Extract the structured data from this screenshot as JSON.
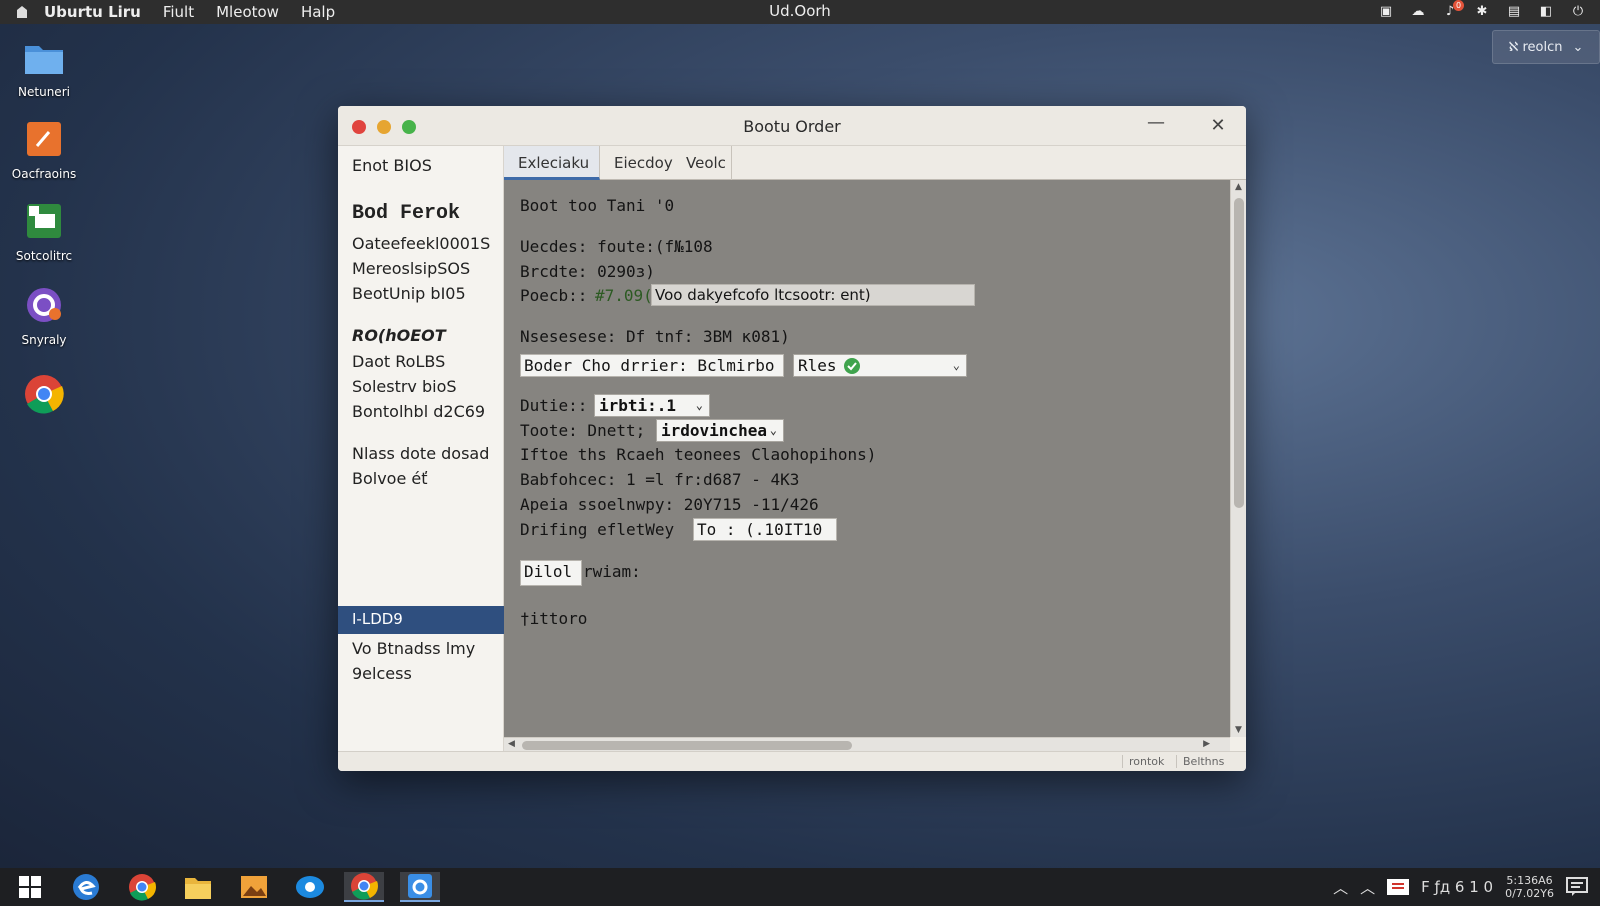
{
  "topbar": {
    "app_name": "Uburtu Liru",
    "menus": [
      "Fiult",
      "Mleotow",
      "Halp"
    ],
    "center_title": "Ud.Oorh",
    "tray_badge": "0"
  },
  "screen_button": {
    "label": "ℵ reolcn"
  },
  "desktop_icons": [
    {
      "label": "Netuneri",
      "icon": "folder-icon"
    },
    {
      "label": "Oacfraoins",
      "icon": "tools-app-icon"
    },
    {
      "label": "Sotcolitrc",
      "icon": "spreadsheet-app-icon"
    },
    {
      "label": "Snyraly",
      "icon": "chat-app-icon"
    },
    {
      "label": "",
      "icon": "chrome-icon"
    }
  ],
  "window": {
    "title": "Bootu Order",
    "minimize_glyph": "—",
    "close_glyph": "✕"
  },
  "sidebar": {
    "top": "Enot BIOS",
    "heading": "Bod Ferok",
    "group1": [
      "Oateefeekl0001S",
      "MereoslsipSOS",
      "BeotUnip bI05"
    ],
    "subheading": "RO(һOEOT",
    "group2": [
      "Daot RoLBS",
      "Solestrv bioS",
      "Bontolhbl d2C69"
    ],
    "group3": [
      "Nlass dote dosad",
      "Bolvoe éť"
    ],
    "selected": "I-LDD9",
    "group4": [
      "Vo Btnadss lmy",
      "9elcess"
    ]
  },
  "tabs": [
    "Exleciaku",
    "Eiecdoy",
    "Veolc"
  ],
  "content": {
    "line1": "Boot too Tani '0",
    "line2": "Uecdes:  foute:(f№108",
    "line3": "Brcdte:  0290з)",
    "line4_label": "Poecb::",
    "line4_value": "#7.09(",
    "line4_box": "Voo dakyefcofo ltcsootr: ent)",
    "line5": "Nsesesese: Df tnf: 3BM ĸ081)",
    "line6_box": "Boder Cho drrier: Bclmirbo",
    "line6_select": "Rles",
    "line7_label": "Dutie::",
    "line7_select": "irbti:.1",
    "line8_label": "Toote: Dnett;",
    "line8_select": "irdovinchea",
    "line9": "Iftoe ths Rcaeh teonees Claohopihons)",
    "line10": "Babfohcec: 1 =l fr:d687 - 4K3",
    "line11": "Apeia ssoelnwpy: 20Y715 -11/426",
    "line12_label": "Drifing efletWey",
    "line12_box": "To :  (.10IT10",
    "button_label": "Dilol",
    "button_suffix": "rwiam:",
    "footer": "†ittoro"
  },
  "statusbar": [
    "rontok",
    "Belthns"
  ],
  "taskbar": {
    "apps": [
      "windows-start-icon",
      "edge-icon",
      "chrome-icon",
      "file-explorer-icon",
      "photos-app-icon",
      "mail-app-icon",
      "chrome-icon",
      "store-app-icon"
    ],
    "systray_text": "F ƒд 6 1 0",
    "clock_line1": "5:136A6",
    "clock_line2": "0/7.02Y6"
  },
  "colors": {
    "accent": "#2f4f7f",
    "content_bg": "#868480",
    "traffic_red": "#e0443e",
    "traffic_yellow": "#e6a531",
    "traffic_green": "#47b34a",
    "check_green": "#3fa34d"
  }
}
